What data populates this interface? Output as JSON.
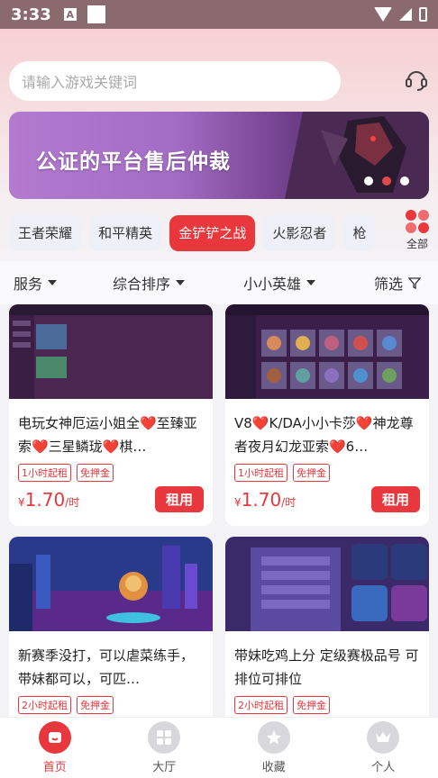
{
  "status_bar": {
    "time": "3:33",
    "a_icon": "A"
  },
  "search": {
    "placeholder": "请输入游戏关键词"
  },
  "banner": {
    "text": "公证的平台售后仲裁"
  },
  "game_tabs": [
    "王者荣耀",
    "和平精英",
    "金铲铲之战",
    "火影忍者",
    "枪"
  ],
  "active_tab": "金铲铲之战",
  "all_label": "全部",
  "filters": {
    "service": "服务",
    "sort": "综合排序",
    "hero": "小小英雄",
    "filter": "筛选"
  },
  "cards": [
    {
      "title": "电玩女神厄运小姐全❤️至臻亚索❤️三星鳞珑❤️棋…",
      "tags": [
        "1小时起租",
        "免押金"
      ],
      "price": "1.70",
      "unit": "/时",
      "currency": "¥",
      "button": "租用"
    },
    {
      "title": "V8❤️K/DA小小卡莎❤️神龙尊者夜月幻龙亚索❤️6…",
      "tags": [
        "1小时起租",
        "免押金"
      ],
      "price": "1.70",
      "unit": "/时",
      "currency": "¥",
      "button": "租用"
    },
    {
      "title": "新赛季没打，可以虐菜练手，带妹都可以，可匹…",
      "tags": [
        "2小时起租",
        "免押金"
      ]
    },
    {
      "title": "带妹吃鸡上分 定级赛极品号 可排位可排位",
      "tags": [
        "2小时起租",
        "免押金"
      ]
    }
  ],
  "bottom_nav": [
    "首页",
    "大厅",
    "收藏",
    "个人"
  ],
  "colors": {
    "accent": "#e8383d"
  }
}
